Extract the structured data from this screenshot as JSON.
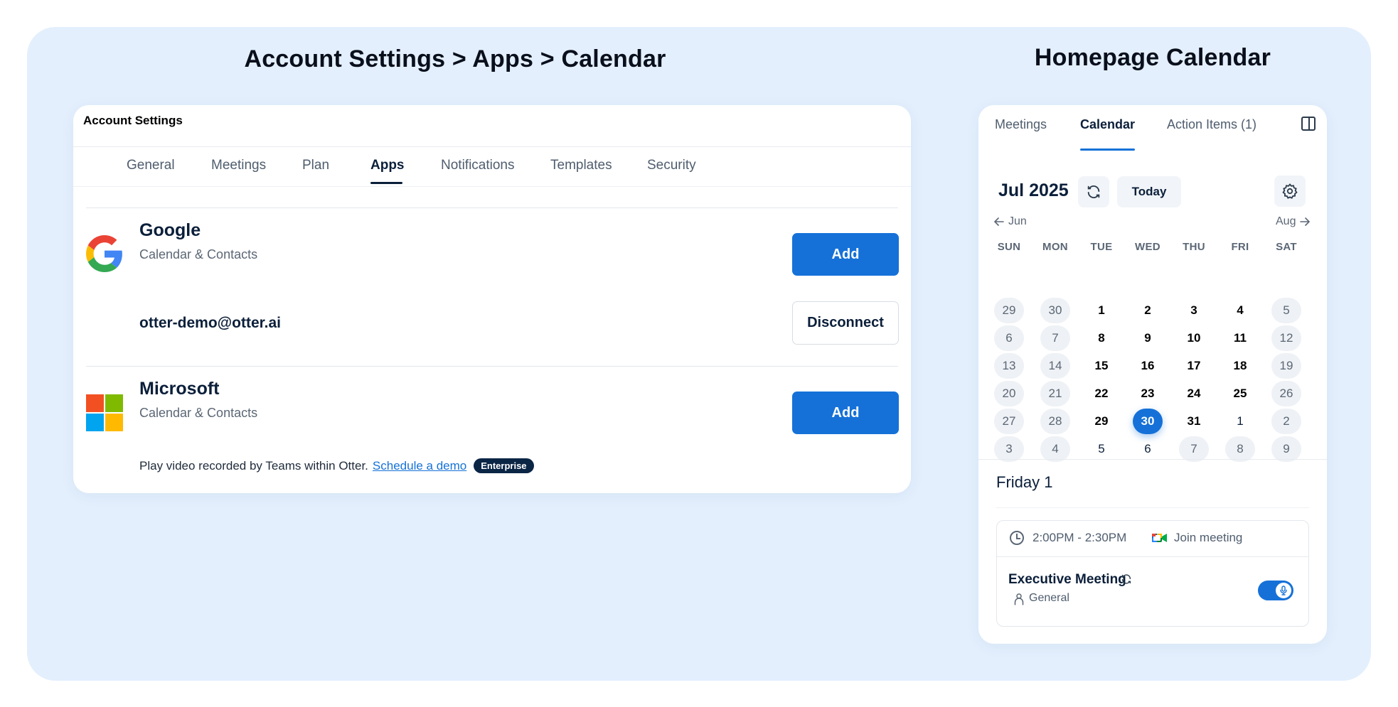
{
  "titles": {
    "left": "Account Settings > Apps > Calendar",
    "right": "Homepage Calendar"
  },
  "account_settings": {
    "header": "Account Settings",
    "tabs": [
      "General",
      "Meetings",
      "Plan",
      "Apps",
      "Notifications",
      "Templates",
      "Security"
    ],
    "active_tab": "Apps",
    "providers": {
      "google": {
        "name": "Google",
        "subtitle": "Calendar & Contacts",
        "add_label": "Add",
        "connected_email": "otter-demo@otter.ai",
        "disconnect_label": "Disconnect"
      },
      "microsoft": {
        "name": "Microsoft",
        "subtitle": "Calendar & Contacts",
        "add_label": "Add",
        "note_text": "Play video recorded by Teams within Otter.",
        "note_link": "Schedule a demo",
        "badge": "Enterprise"
      }
    }
  },
  "homepage_calendar": {
    "tabs": [
      "Meetings",
      "Calendar",
      "Action Items (1)"
    ],
    "active_tab": "Calendar",
    "month_label": "Jul 2025",
    "today_label": "Today",
    "prev_month": "Jun",
    "next_month": "Aug",
    "weekdays": [
      "SUN",
      "MON",
      "TUE",
      "WED",
      "THU",
      "FRI",
      "SAT"
    ],
    "weeks": [
      [
        {
          "d": "29",
          "s": "muted"
        },
        {
          "d": "30",
          "s": "muted"
        },
        {
          "d": "1",
          "s": "bold"
        },
        {
          "d": "2",
          "s": "bold"
        },
        {
          "d": "3",
          "s": "bold"
        },
        {
          "d": "4",
          "s": "bold"
        },
        {
          "d": "5",
          "s": "muted"
        }
      ],
      [
        {
          "d": "6",
          "s": "muted"
        },
        {
          "d": "7",
          "s": "muted"
        },
        {
          "d": "8",
          "s": "bold"
        },
        {
          "d": "9",
          "s": "bold"
        },
        {
          "d": "10",
          "s": "bold"
        },
        {
          "d": "11",
          "s": "bold"
        },
        {
          "d": "12",
          "s": "muted"
        }
      ],
      [
        {
          "d": "13",
          "s": "muted"
        },
        {
          "d": "14",
          "s": "muted"
        },
        {
          "d": "15",
          "s": "bold"
        },
        {
          "d": "16",
          "s": "bold"
        },
        {
          "d": "17",
          "s": "bold"
        },
        {
          "d": "18",
          "s": "bold"
        },
        {
          "d": "19",
          "s": "muted"
        }
      ],
      [
        {
          "d": "20",
          "s": "muted"
        },
        {
          "d": "21",
          "s": "muted"
        },
        {
          "d": "22",
          "s": "bold"
        },
        {
          "d": "23",
          "s": "bold"
        },
        {
          "d": "24",
          "s": "bold"
        },
        {
          "d": "25",
          "s": "bold"
        },
        {
          "d": "26",
          "s": "muted"
        }
      ],
      [
        {
          "d": "27",
          "s": "muted"
        },
        {
          "d": "28",
          "s": "muted"
        },
        {
          "d": "29",
          "s": "bold"
        },
        {
          "d": "30",
          "s": "selected"
        },
        {
          "d": "31",
          "s": "bold"
        },
        {
          "d": "1",
          "s": "plain"
        },
        {
          "d": "2",
          "s": "muted"
        }
      ],
      [
        {
          "d": "3",
          "s": "muted"
        },
        {
          "d": "4",
          "s": "muted"
        },
        {
          "d": "5",
          "s": "plain"
        },
        {
          "d": "6",
          "s": "plain"
        },
        {
          "d": "7",
          "s": "muted"
        },
        {
          "d": "8",
          "s": "muted"
        },
        {
          "d": "9",
          "s": "muted"
        }
      ]
    ],
    "selected_date_heading": "Friday 1",
    "event": {
      "time": "2:00PM - 2:30PM",
      "join_label": "Join meeting",
      "title": "Executive Meeting",
      "channel": "General",
      "recording_enabled": true
    },
    "icons": [
      "refresh-icon",
      "settings-icon",
      "arrow-left-icon",
      "arrow-right-icon",
      "clock-icon",
      "google-meet-icon",
      "repeat-icon",
      "person-icon",
      "microphone-icon",
      "sidebar-collapse-icon"
    ],
    "colors": {
      "accent": "#1571d8",
      "navy": "#0b1f3a",
      "canvas": "#e3effd"
    }
  }
}
